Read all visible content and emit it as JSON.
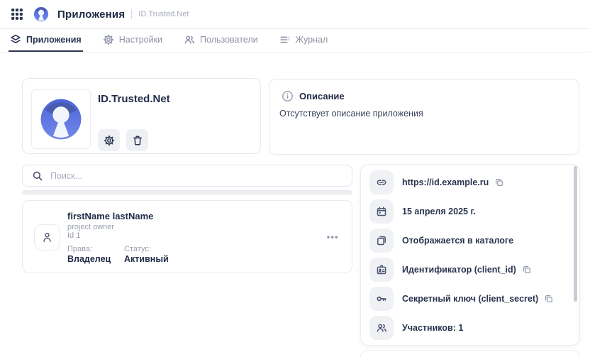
{
  "header": {
    "app_title": "Приложения",
    "context": "ID.Trusted.Net"
  },
  "tabs": {
    "applications": "Приложения",
    "settings": "Настройки",
    "users": "Пользователи",
    "journal": "Журнал"
  },
  "app_card": {
    "name": "ID.Trusted.Net"
  },
  "description": {
    "title": "Описание",
    "empty_text": "Отсутствует описание приложения"
  },
  "search": {
    "placeholder": "Поиск..."
  },
  "member": {
    "name": "firstName lastName",
    "role": "project owner",
    "id": "Id 1",
    "rights_label": "Права:",
    "rights_value": "Владелец",
    "status_label": "Статус:",
    "status_value": "Активный",
    "menu_label": "•••"
  },
  "details": {
    "items": [
      {
        "name": "app-url",
        "text": "https://id.example.ru"
      },
      {
        "name": "created-date",
        "text": "15 апреля 2025 г."
      },
      {
        "name": "catalog-visibility",
        "text": "Отображается в каталоге"
      },
      {
        "name": "client-id",
        "text": "Идентификатор (client_id)"
      },
      {
        "name": "client-secret",
        "text": "Секретный ключ (client_secret)"
      },
      {
        "name": "members-count",
        "text": "Участников: 1"
      }
    ]
  },
  "colors": {
    "accent_navy": "#2b3550",
    "logo_blue": "#5b76e3",
    "logo_blue_dark": "#46579f",
    "muted_text": "#9aa0b0",
    "chip_bg": "#f0f1f5",
    "card_border": "#e7e9ee"
  }
}
